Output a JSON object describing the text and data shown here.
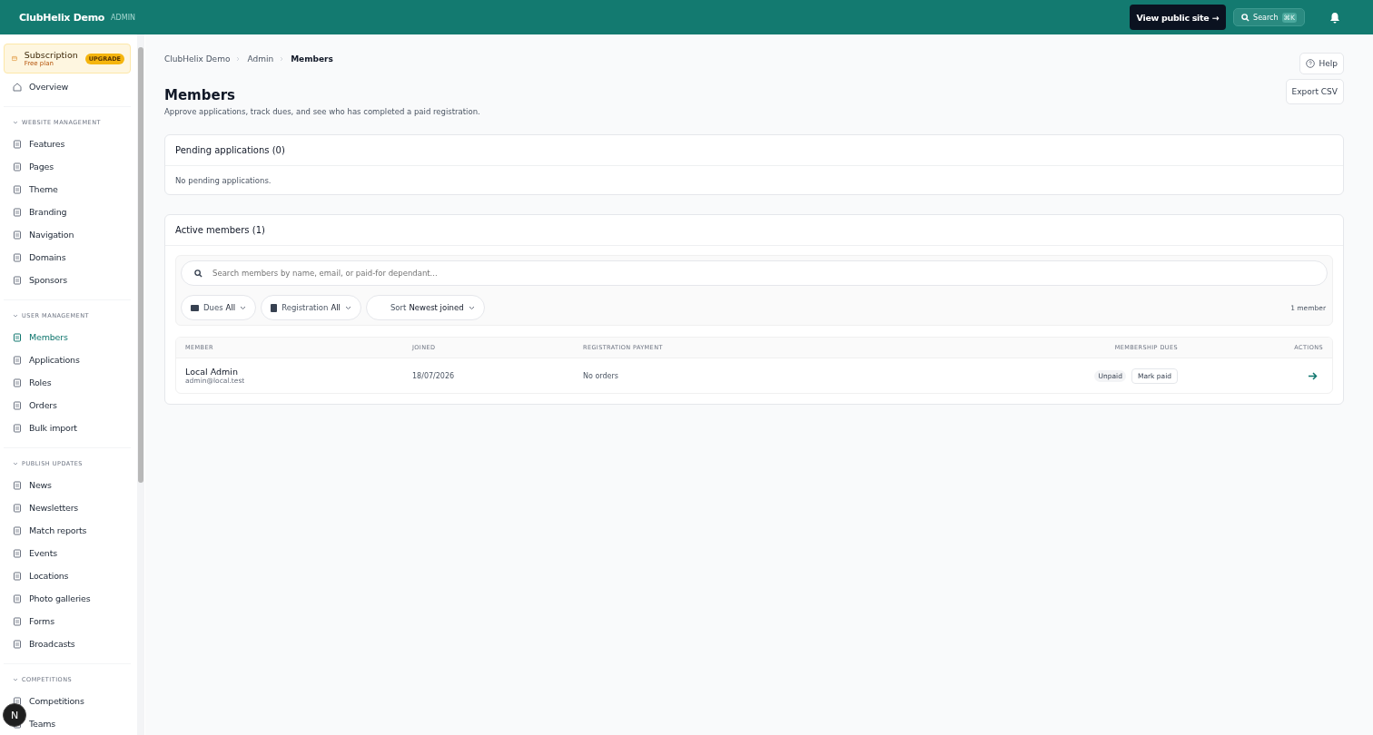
{
  "topbar": {
    "brand": "ClubHelix Demo",
    "role": "ADMIN",
    "public_button": "View public site →",
    "search": {
      "label": "Search",
      "shortcut": "⌘K"
    }
  },
  "sidebar": {
    "subscription": {
      "title": "Subscription",
      "plan": "Free plan",
      "badge": "UPGRADE"
    },
    "top_items": [
      {
        "label": "Overview",
        "selected": false
      }
    ],
    "groups": [
      {
        "title": "WEBSITE MANAGEMENT",
        "expanded": true,
        "items": [
          {
            "label": "Features",
            "selected": false
          },
          {
            "label": "Pages",
            "selected": false
          },
          {
            "label": "Theme",
            "selected": false
          },
          {
            "label": "Branding",
            "selected": false
          },
          {
            "label": "Navigation",
            "selected": false
          },
          {
            "label": "Domains",
            "selected": false
          },
          {
            "label": "Sponsors",
            "selected": false
          }
        ]
      },
      {
        "title": "USER MANAGEMENT",
        "expanded": true,
        "items": [
          {
            "label": "Members",
            "selected": true
          },
          {
            "label": "Applications",
            "selected": false
          },
          {
            "label": "Roles",
            "selected": false
          },
          {
            "label": "Orders",
            "selected": false
          },
          {
            "label": "Bulk import",
            "selected": false
          }
        ]
      },
      {
        "title": "PUBLISH UPDATES",
        "expanded": true,
        "items": [
          {
            "label": "News",
            "selected": false
          },
          {
            "label": "Newsletters",
            "selected": false
          },
          {
            "label": "Match reports",
            "selected": false
          },
          {
            "label": "Events",
            "selected": false
          },
          {
            "label": "Locations",
            "selected": false
          },
          {
            "label": "Photo galleries",
            "selected": false
          },
          {
            "label": "Forms",
            "selected": false
          },
          {
            "label": "Broadcasts",
            "selected": false
          }
        ]
      },
      {
        "title": "COMPETITIONS",
        "expanded": true,
        "items": [
          {
            "label": "Competitions",
            "selected": false
          },
          {
            "label": "Teams",
            "selected": false
          }
        ]
      }
    ]
  },
  "avatar": "N",
  "breadcrumb": [
    "ClubHelix Demo",
    "Admin",
    "Members"
  ],
  "help_button": "Help",
  "page": {
    "title": "Members",
    "subtitle": "Approve applications, track dues, and see who has completed a paid registration.",
    "export_button": "Export CSV"
  },
  "pending": {
    "title": "Pending applications (0)",
    "empty": "No pending applications."
  },
  "active": {
    "title": "Active members (1)",
    "search": {
      "placeholder": "Search members by name, email, or paid-for dependant..."
    },
    "filters": [
      {
        "label": "Dues",
        "value": "All"
      },
      {
        "label": "Registration",
        "value": "All"
      },
      {
        "label": "Sort",
        "value": "Newest joined"
      }
    ],
    "count": "1 member",
    "table": {
      "columns": [
        "MEMBER",
        "JOINED",
        "REGISTRATION PAYMENT",
        "MEMBERSHIP DUES",
        "ACTIONS"
      ],
      "rows": [
        {
          "name": "Local Admin",
          "email": "admin@local.test",
          "joined": "18/07/2026",
          "registration": "No orders",
          "dues_status": "Unpaid",
          "dues_action": "Mark paid"
        }
      ]
    }
  }
}
